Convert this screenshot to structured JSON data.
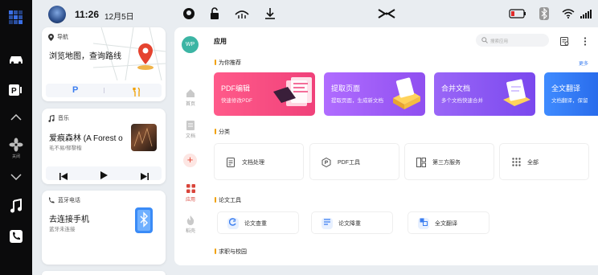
{
  "status_bar": {
    "time": "11:26",
    "date": "12月5日"
  },
  "dock": {
    "fan_label": "关闭"
  },
  "widgets": {
    "nav": {
      "header": "导航",
      "title": "浏览地图，查询路线",
      "parking_label": "P"
    },
    "music": {
      "header": "音乐",
      "title": "爱痕森林 (A Forest o",
      "subtitle": "毛不易/郁黎楷"
    },
    "phone": {
      "header": "蓝牙电话",
      "title": "去连接手机",
      "subtitle": "蓝牙未连接"
    }
  },
  "app": {
    "avatar": "WP",
    "title": "应用",
    "search_placeholder": "搜索应用",
    "rail": [
      {
        "label": "首页"
      },
      {
        "label": "文档"
      },
      {
        "label": "应用"
      },
      {
        "label": "稻壳"
      }
    ],
    "recommend": {
      "title": "为你推荐",
      "more": "更多",
      "items": [
        {
          "title": "PDF编辑",
          "subtitle": "快速修改PDF",
          "color": "#f04f82"
        },
        {
          "title": "提取页面",
          "subtitle": "提取页面，生成新文档",
          "color": "#a05cf5"
        },
        {
          "title": "合并文档",
          "subtitle": "多个文档快速合并",
          "color": "#8a5af2"
        },
        {
          "title": "全文翻译",
          "subtitle": "文档翻译，保留",
          "color": "#2f7cf6"
        }
      ]
    },
    "categories": {
      "title": "分类",
      "items": [
        {
          "label": "文档处理",
          "icon": "doc-icon"
        },
        {
          "label": "PDF工具",
          "icon": "pdf-icon"
        },
        {
          "label": "第三方服务",
          "icon": "grid-icon"
        },
        {
          "label": "全部",
          "icon": "dots-icon"
        }
      ]
    },
    "thesis": {
      "title": "论文工具",
      "items": [
        {
          "label": "论文查重",
          "icon": "check-icon",
          "color": "#3b7ef0"
        },
        {
          "label": "论文降重",
          "icon": "list-icon",
          "color": "#3b7ef0"
        },
        {
          "label": "全文翻译",
          "icon": "translate-icon",
          "color": "#3b7ef0"
        }
      ]
    },
    "career": {
      "title": "求职与校园"
    }
  }
}
